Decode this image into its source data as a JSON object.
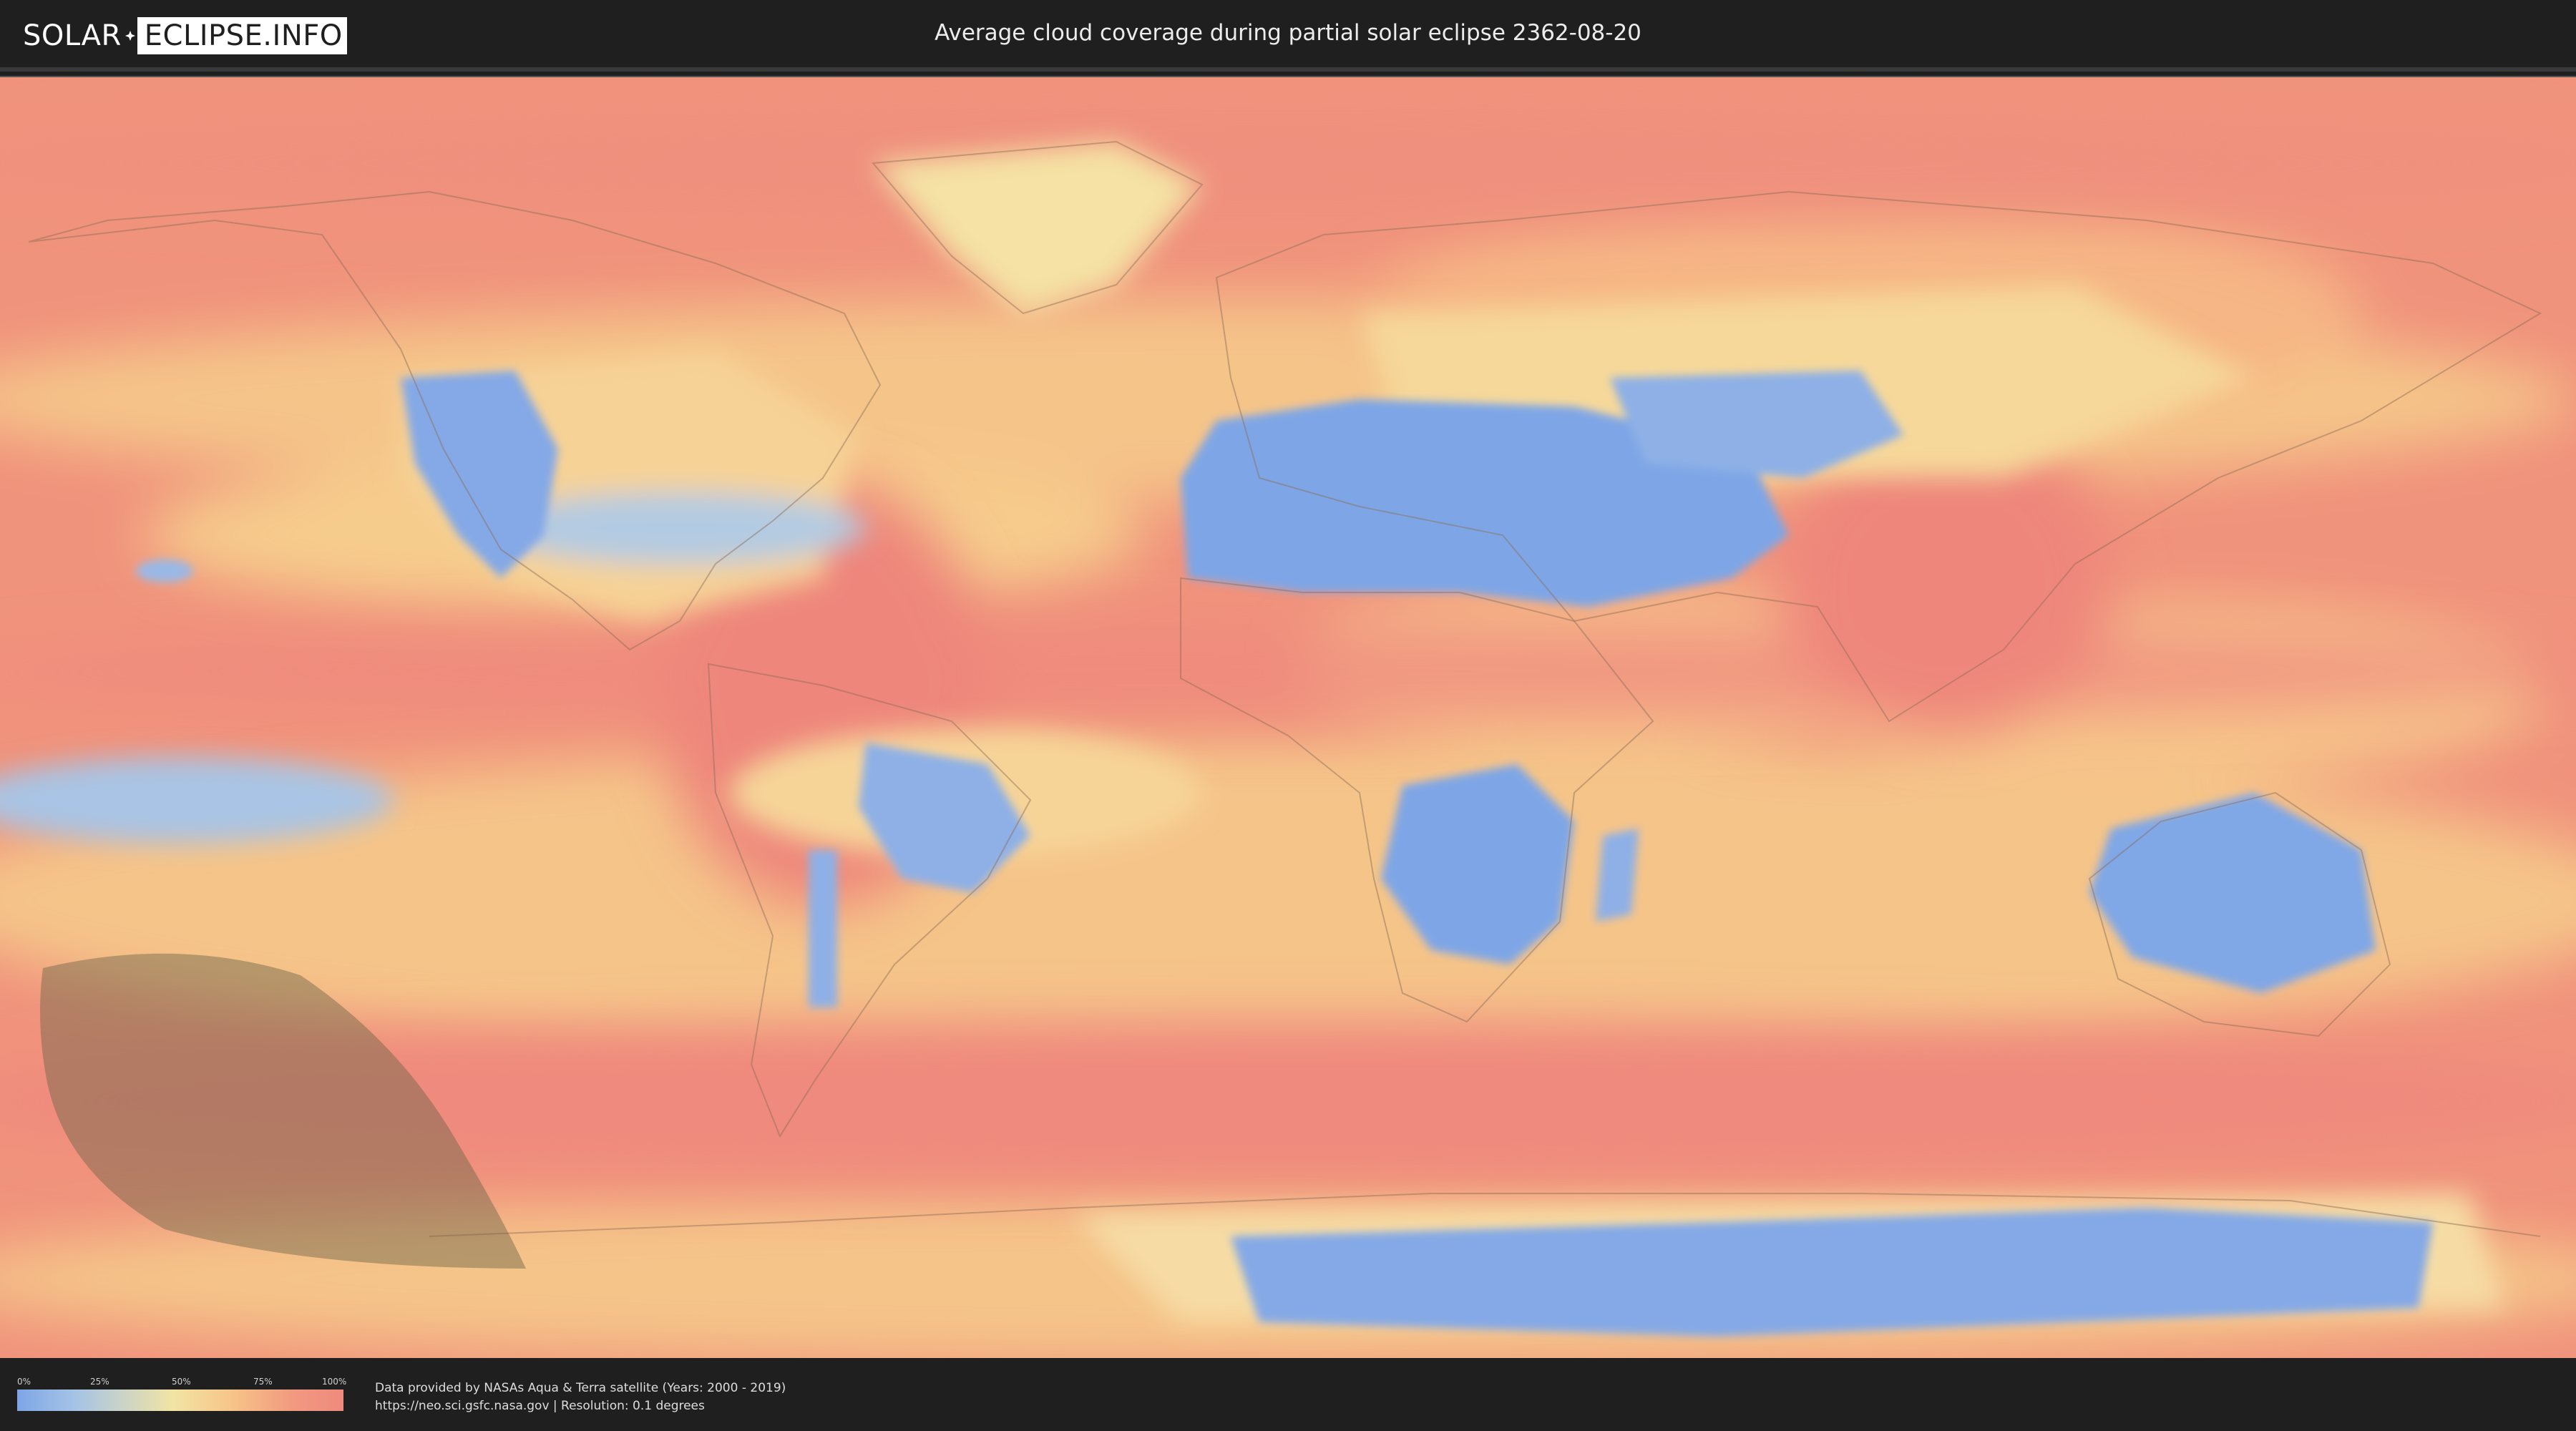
{
  "header": {
    "logo_left": "SOLAR",
    "logo_right": "ECLIPSE.INFO",
    "title": "Average cloud coverage during partial solar eclipse 2362-08-20"
  },
  "map": {
    "icon": "world-cloud-coverage-map",
    "colors": {
      "clear": "#7ea6e6",
      "low": "#a6c4e6",
      "mid": "#f2e4a4",
      "high": "#f7c488",
      "very_high": "#ef8a7e",
      "eclipse_shadow": "#6b6446"
    }
  },
  "legend": {
    "labels": [
      "0%",
      "25%",
      "50%",
      "75%",
      "100%"
    ]
  },
  "credits": {
    "line1": "Data provided by NASAs Aqua & Terra satellite (Years: 2000 - 2019)",
    "line2": "https://neo.sci.gsfc.nasa.gov | Resolution: 0.1 degrees"
  }
}
